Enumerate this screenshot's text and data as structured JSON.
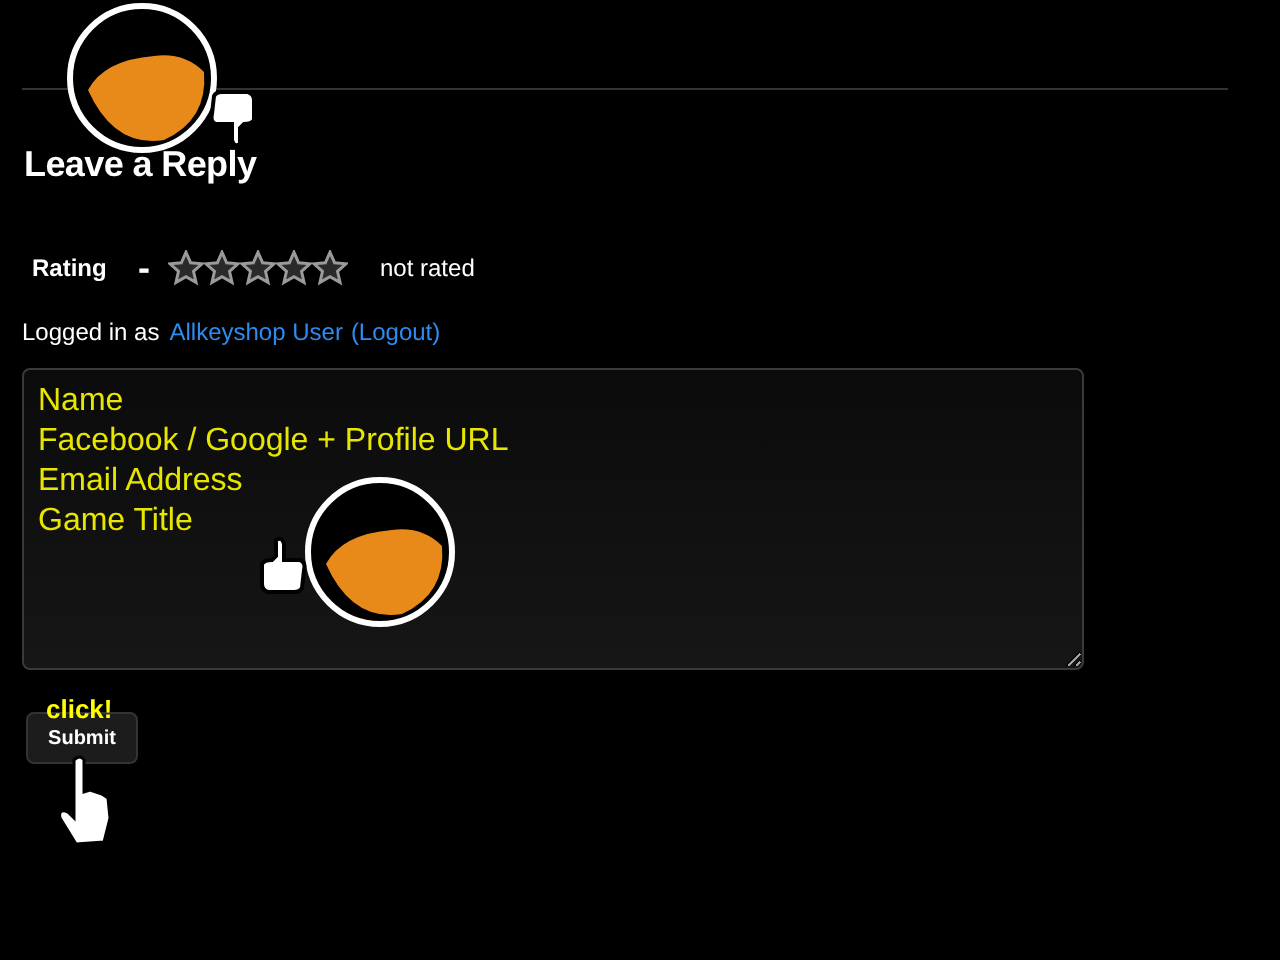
{
  "heading": "Leave a Reply",
  "rating": {
    "label": "Rating",
    "clear": "-",
    "stars": 0,
    "status": "not rated"
  },
  "login": {
    "prefix": "Logged in as",
    "user": "Allkeyshop User",
    "logout": "(Logout)"
  },
  "comment": {
    "placeholder": "Name\nFacebook / Google + Profile URL\nEmail Address\nGame Title"
  },
  "hint": "click!",
  "submit": "Submit"
}
